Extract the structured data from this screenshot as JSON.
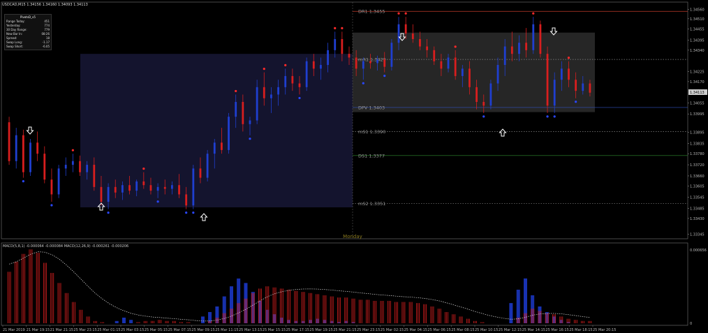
{
  "symbol_title": "USDCAD,M15  1.34156 1.34160 1.34093 1.34113",
  "info_box": {
    "header": "PivotsD_v5",
    "rows": [
      {
        "label": "Range Today:",
        "value": "451"
      },
      {
        "label": "Yesterday:",
        "value": "774"
      },
      {
        "label": "30 Day Range:",
        "value": "779"
      },
      {
        "label": "New Bar In:",
        "value": "08:26"
      },
      {
        "label": "Spread:",
        "value": "18"
      },
      {
        "label": "Swap Long:",
        "value": "-1.17"
      },
      {
        "label": "Swap Short:",
        "value": "-6.05"
      }
    ]
  },
  "pivots": [
    {
      "label": "DR1",
      "price": 1.3455,
      "text": "1.3455",
      "color": "#c0392b",
      "style": "solid"
    },
    {
      "label": "mR1",
      "price": 1.3429,
      "text": "1.3429",
      "color": "#888888",
      "style": "dotted"
    },
    {
      "label": "DPV",
      "price": 1.3403,
      "text": "1.3403",
      "color": "#3050c0",
      "style": "solid"
    },
    {
      "label": "mS1",
      "price": 1.339,
      "text": "1.3390",
      "color": "#888888",
      "style": "dotted"
    },
    {
      "label": "DS1",
      "price": 1.3377,
      "text": "1.3377",
      "color": "#2e8b2e",
      "style": "solid"
    },
    {
      "label": "mS2",
      "price": 1.3351,
      "text": "1.3351",
      "color": "#888888",
      "style": "dotted"
    }
  ],
  "day_label": "Monday",
  "price_axis": [
    {
      "price": 1.3456,
      "text": "1.34560"
    },
    {
      "price": 1.3451,
      "text": "1.34510"
    },
    {
      "price": 1.34455,
      "text": "1.34455"
    },
    {
      "price": 1.34395,
      "text": "1.34395"
    },
    {
      "price": 1.3434,
      "text": "1.34340"
    },
    {
      "price": 1.34225,
      "text": "1.34225"
    },
    {
      "price": 1.3417,
      "text": "1.34170"
    },
    {
      "price": 1.34113,
      "text": "1.34113",
      "current": true
    },
    {
      "price": 1.34055,
      "text": "1.34055"
    },
    {
      "price": 1.33995,
      "text": "1.33995"
    },
    {
      "price": 1.33895,
      "text": "1.33895"
    },
    {
      "price": 1.33835,
      "text": "1.33835"
    },
    {
      "price": 1.3378,
      "text": "1.33780"
    },
    {
      "price": 1.3372,
      "text": "1.33720"
    },
    {
      "price": 1.3366,
      "text": "1.33660"
    },
    {
      "price": 1.33605,
      "text": "1.33605"
    },
    {
      "price": 1.33545,
      "text": "1.33545"
    },
    {
      "price": 1.33485,
      "text": "1.33485"
    },
    {
      "price": 1.3343,
      "text": "1.33430"
    },
    {
      "price": 1.33345,
      "text": "1.33345"
    }
  ],
  "macd_title": "MACD(5,8,1) -0.000064 -0.000084  MACD(12,26,9) -0.000261 -0.000206",
  "macd_axis": [
    {
      "value": 0.0006556,
      "text": "0.000656"
    },
    {
      "value": 0,
      "text": "0"
    }
  ],
  "time_axis": [
    "21 Mar 2019",
    "21 Mar 19:15",
    "21 Mar 21:15",
    "25 Mar 23:15",
    "25 Mar 01:15",
    "25 Mar 03:15",
    "25 Mar 05:15",
    "25 Mar 07:15",
    "25 Mar 09:15",
    "25 Mar 11:15",
    "25 Mar 13:15",
    "25 Mar 15:15",
    "25 Mar 17:15",
    "25 Mar 19:15",
    "25 Mar 21:15",
    "25 Mar 23:15",
    "25 Mar 02:15",
    "25 Mar 04:15",
    "25 Mar 06:15",
    "25 Mar 08:15",
    "25 Mar 10:15",
    "25 Mar 12:15",
    "25 Mar 14:15",
    "25 Mar 16:15",
    "25 Mar 18:15",
    "25 Mar 20:15"
  ],
  "colors": {
    "bull": "#1f3fd0",
    "bear": "#d81e1e",
    "dot_red": "#ff2a2a",
    "dot_blue": "#2a47ff",
    "box_prev": "#14142e",
    "box_curr": "#262626"
  },
  "candles": [
    {
      "o": 1.3395,
      "h": 1.3398,
      "l": 1.3372,
      "c": 1.3374
    },
    {
      "o": 1.3374,
      "h": 1.3392,
      "l": 1.337,
      "c": 1.3388
    },
    {
      "o": 1.3388,
      "h": 1.3391,
      "l": 1.3365,
      "c": 1.3368
    },
    {
      "o": 1.3368,
      "h": 1.3386,
      "l": 1.3366,
      "c": 1.3384
    },
    {
      "o": 1.3384,
      "h": 1.339,
      "l": 1.3374,
      "c": 1.3378
    },
    {
      "o": 1.3378,
      "h": 1.3382,
      "l": 1.3362,
      "c": 1.3364
    },
    {
      "o": 1.3364,
      "h": 1.337,
      "l": 1.3352,
      "c": 1.3356
    },
    {
      "o": 1.3356,
      "h": 1.3372,
      "l": 1.3354,
      "c": 1.337
    },
    {
      "o": 1.337,
      "h": 1.3376,
      "l": 1.3366,
      "c": 1.3372
    },
    {
      "o": 1.3372,
      "h": 1.3378,
      "l": 1.3368,
      "c": 1.3374
    },
    {
      "o": 1.3374,
      "h": 1.3377,
      "l": 1.3366,
      "c": 1.3368
    },
    {
      "o": 1.3368,
      "h": 1.3374,
      "l": 1.3364,
      "c": 1.3372
    },
    {
      "o": 1.3372,
      "h": 1.3376,
      "l": 1.3358,
      "c": 1.336
    },
    {
      "o": 1.336,
      "h": 1.3366,
      "l": 1.335,
      "c": 1.3352
    },
    {
      "o": 1.3352,
      "h": 1.3362,
      "l": 1.3348,
      "c": 1.336
    },
    {
      "o": 1.336,
      "h": 1.3364,
      "l": 1.3354,
      "c": 1.3357
    },
    {
      "o": 1.3357,
      "h": 1.3363,
      "l": 1.3353,
      "c": 1.3361
    },
    {
      "o": 1.3361,
      "h": 1.3366,
      "l": 1.3356,
      "c": 1.3358
    },
    {
      "o": 1.3358,
      "h": 1.3364,
      "l": 1.3355,
      "c": 1.3363
    },
    {
      "o": 1.3363,
      "h": 1.3368,
      "l": 1.3359,
      "c": 1.3361
    },
    {
      "o": 1.3361,
      "h": 1.3365,
      "l": 1.3356,
      "c": 1.3358
    },
    {
      "o": 1.3358,
      "h": 1.3362,
      "l": 1.3354,
      "c": 1.336
    },
    {
      "o": 1.336,
      "h": 1.3364,
      "l": 1.3356,
      "c": 1.3359
    },
    {
      "o": 1.3359,
      "h": 1.3363,
      "l": 1.3356,
      "c": 1.3361
    },
    {
      "o": 1.3361,
      "h": 1.3367,
      "l": 1.3354,
      "c": 1.3356
    },
    {
      "o": 1.3356,
      "h": 1.336,
      "l": 1.3348,
      "c": 1.335
    },
    {
      "o": 1.335,
      "h": 1.3372,
      "l": 1.3348,
      "c": 1.337
    },
    {
      "o": 1.337,
      "h": 1.3376,
      "l": 1.3362,
      "c": 1.3365
    },
    {
      "o": 1.3365,
      "h": 1.338,
      "l": 1.3363,
      "c": 1.3378
    },
    {
      "o": 1.3378,
      "h": 1.3386,
      "l": 1.337,
      "c": 1.3384
    },
    {
      "o": 1.3384,
      "h": 1.3392,
      "l": 1.3378,
      "c": 1.338
    },
    {
      "o": 1.338,
      "h": 1.34,
      "l": 1.3378,
      "c": 1.3398
    },
    {
      "o": 1.3398,
      "h": 1.341,
      "l": 1.3392,
      "c": 1.3406
    },
    {
      "o": 1.3406,
      "h": 1.341,
      "l": 1.339,
      "c": 1.3394
    },
    {
      "o": 1.3394,
      "h": 1.3398,
      "l": 1.3388,
      "c": 1.3396
    },
    {
      "o": 1.3396,
      "h": 1.3418,
      "l": 1.3394,
      "c": 1.3414
    },
    {
      "o": 1.3414,
      "h": 1.3422,
      "l": 1.3404,
      "c": 1.3408
    },
    {
      "o": 1.3408,
      "h": 1.3414,
      "l": 1.34,
      "c": 1.341
    },
    {
      "o": 1.341,
      "h": 1.3418,
      "l": 1.3404,
      "c": 1.3414
    },
    {
      "o": 1.3414,
      "h": 1.3424,
      "l": 1.341,
      "c": 1.342
    },
    {
      "o": 1.342,
      "h": 1.3424,
      "l": 1.3412,
      "c": 1.3416
    },
    {
      "o": 1.3416,
      "h": 1.342,
      "l": 1.341,
      "c": 1.3414
    },
    {
      "o": 1.3414,
      "h": 1.343,
      "l": 1.3412,
      "c": 1.3428
    },
    {
      "o": 1.3428,
      "h": 1.3432,
      "l": 1.342,
      "c": 1.3424
    },
    {
      "o": 1.3424,
      "h": 1.343,
      "l": 1.3418,
      "c": 1.3426
    },
    {
      "o": 1.3426,
      "h": 1.3438,
      "l": 1.3422,
      "c": 1.3434
    },
    {
      "o": 1.3434,
      "h": 1.3444,
      "l": 1.343,
      "c": 1.344
    },
    {
      "o": 1.344,
      "h": 1.3444,
      "l": 1.3428,
      "c": 1.3432
    },
    {
      "o": 1.3432,
      "h": 1.3436,
      "l": 1.3426,
      "c": 1.343
    },
    {
      "o": 1.343,
      "h": 1.3434,
      "l": 1.342,
      "c": 1.3424
    },
    {
      "o": 1.3424,
      "h": 1.343,
      "l": 1.3418,
      "c": 1.3428
    },
    {
      "o": 1.3428,
      "h": 1.3432,
      "l": 1.3424,
      "c": 1.3427
    },
    {
      "o": 1.3427,
      "h": 1.3431,
      "l": 1.3423,
      "c": 1.3429
    },
    {
      "o": 1.3429,
      "h": 1.3433,
      "l": 1.3422,
      "c": 1.3425
    },
    {
      "o": 1.3425,
      "h": 1.344,
      "l": 1.3423,
      "c": 1.3438
    },
    {
      "o": 1.3438,
      "h": 1.3452,
      "l": 1.3434,
      "c": 1.3448
    },
    {
      "o": 1.3448,
      "h": 1.3452,
      "l": 1.344,
      "c": 1.3443
    },
    {
      "o": 1.3443,
      "h": 1.3448,
      "l": 1.3438,
      "c": 1.344
    },
    {
      "o": 1.344,
      "h": 1.3444,
      "l": 1.3434,
      "c": 1.3436
    },
    {
      "o": 1.3436,
      "h": 1.344,
      "l": 1.343,
      "c": 1.3434
    },
    {
      "o": 1.3434,
      "h": 1.3436,
      "l": 1.3426,
      "c": 1.3428
    },
    {
      "o": 1.3428,
      "h": 1.3432,
      "l": 1.342,
      "c": 1.3424
    },
    {
      "o": 1.3424,
      "h": 1.3432,
      "l": 1.3422,
      "c": 1.343
    },
    {
      "o": 1.343,
      "h": 1.3434,
      "l": 1.3418,
      "c": 1.342
    },
    {
      "o": 1.342,
      "h": 1.3426,
      "l": 1.3414,
      "c": 1.3424
    },
    {
      "o": 1.3424,
      "h": 1.3428,
      "l": 1.341,
      "c": 1.3414
    },
    {
      "o": 1.3414,
      "h": 1.3418,
      "l": 1.3402,
      "c": 1.3406
    },
    {
      "o": 1.3406,
      "h": 1.341,
      "l": 1.34,
      "c": 1.3404
    },
    {
      "o": 1.3404,
      "h": 1.3418,
      "l": 1.3402,
      "c": 1.3416
    },
    {
      "o": 1.3416,
      "h": 1.343,
      "l": 1.3412,
      "c": 1.3426
    },
    {
      "o": 1.3426,
      "h": 1.344,
      "l": 1.342,
      "c": 1.3436
    },
    {
      "o": 1.3436,
      "h": 1.3444,
      "l": 1.3428,
      "c": 1.3432
    },
    {
      "o": 1.3432,
      "h": 1.3442,
      "l": 1.3428,
      "c": 1.3438
    },
    {
      "o": 1.3438,
      "h": 1.3446,
      "l": 1.343,
      "c": 1.3434
    },
    {
      "o": 1.3434,
      "h": 1.3452,
      "l": 1.3432,
      "c": 1.3448
    },
    {
      "o": 1.3448,
      "h": 1.345,
      "l": 1.343,
      "c": 1.3432
    },
    {
      "o": 1.3432,
      "h": 1.3436,
      "l": 1.34,
      "c": 1.3404
    },
    {
      "o": 1.3404,
      "h": 1.3422,
      "l": 1.34,
      "c": 1.3418
    },
    {
      "o": 1.3418,
      "h": 1.3428,
      "l": 1.3412,
      "c": 1.3424
    },
    {
      "o": 1.3424,
      "h": 1.3428,
      "l": 1.3414,
      "c": 1.3418
    },
    {
      "o": 1.3418,
      "h": 1.3422,
      "l": 1.3408,
      "c": 1.3412
    },
    {
      "o": 1.3412,
      "h": 1.342,
      "l": 1.341,
      "c": 1.3416
    },
    {
      "o": 1.3416,
      "h": 1.3418,
      "l": 1.3409,
      "c": 1.3411
    }
  ],
  "macd_hist_red": [
    0.00046,
    0.00055,
    0.00062,
    0.00066,
    0.00063,
    0.00054,
    0.00045,
    0.00036,
    0.00027,
    0.00019,
    0.00012,
    6e-05,
    2e-05,
    1e-05,
    0,
    0,
    0,
    0,
    1e-05,
    2e-05,
    2e-05,
    3e-05,
    2e-05,
    2e-05,
    1e-05,
    1e-05,
    0,
    0,
    2e-05,
    5e-05,
    9e-05,
    0.00013,
    0.00018,
    0.00022,
    0.00027,
    0.00031,
    0.00033,
    0.00032,
    0.00031,
    0.0003,
    0.00029,
    0.00028,
    0.00027,
    0.00026,
    0.00025,
    0.00024,
    0.00023,
    0.00023,
    0.00022,
    0.00021,
    0.00021,
    0.0002,
    0.0002,
    0.0002,
    0.00019,
    0.00019,
    0.00019,
    0.00018,
    0.00017,
    0.00015,
    0.00013,
    0.0001,
    8e-05,
    6e-05,
    4e-05,
    2e-05,
    1e-05,
    0,
    0,
    0,
    0,
    5e-05,
    9e-05,
    0.00013,
    0.00011,
    9e-05,
    8e-05,
    6e-05,
    4e-05,
    3e-05,
    2e-05,
    2e-05
  ],
  "macd_hist_blue": [
    0,
    0,
    0,
    0,
    0,
    0,
    0,
    0,
    0,
    0,
    0,
    0,
    0,
    0,
    0,
    2e-05,
    5e-05,
    3e-05,
    0,
    0,
    0,
    0,
    0,
    0,
    0,
    0,
    0,
    6e-05,
    0.0001,
    0.00015,
    0.00024,
    0.00033,
    0.0004,
    0.00036,
    0.00028,
    0.0002,
    0.00012,
    8e-05,
    5e-05,
    3e-05,
    2e-05,
    2e-05,
    3e-05,
    4e-05,
    3e-05,
    2e-05,
    1e-05,
    2e-05,
    1e-05,
    0,
    0,
    0,
    0,
    0,
    0,
    0,
    0,
    0,
    0,
    0,
    0,
    0,
    0,
    0,
    0,
    0,
    0,
    0,
    0,
    0,
    0.00018,
    0.0003,
    0.0004,
    0.00025,
    0.00015,
    0.0001,
    6e-05,
    3e-05,
    1e-05,
    0,
    0
  ]
}
